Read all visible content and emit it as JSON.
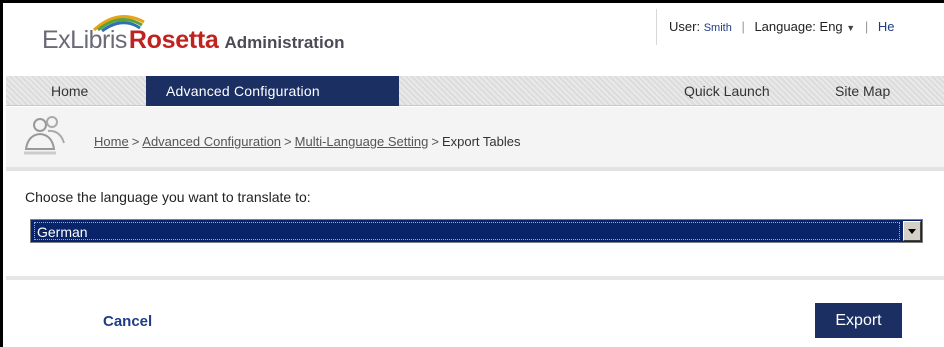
{
  "header": {
    "logo_exlibris": "ExLibris",
    "logo_rosetta": "Rosetta",
    "logo_admin": "Administration",
    "user_label": "User:",
    "user_name": "Smith",
    "language_label": "Language:",
    "language_value": "Eng",
    "help_label": "He"
  },
  "nav": {
    "home": "Home",
    "advanced": "Advanced Configuration",
    "quick_launch": "Quick Launch",
    "site_map": "Site Map"
  },
  "breadcrumb": {
    "items": [
      "Home",
      "Advanced Configuration",
      "Multi-Language Setting"
    ],
    "current": "Export Tables",
    "separator": ">"
  },
  "form": {
    "choose_label": "Choose the language you want to translate to:",
    "selected_language": "German"
  },
  "actions": {
    "cancel": "Cancel",
    "export": "Export"
  },
  "colors": {
    "accent": "#1c2f63",
    "brand_red": "#c0221f",
    "link_blue": "#1f3c88"
  }
}
